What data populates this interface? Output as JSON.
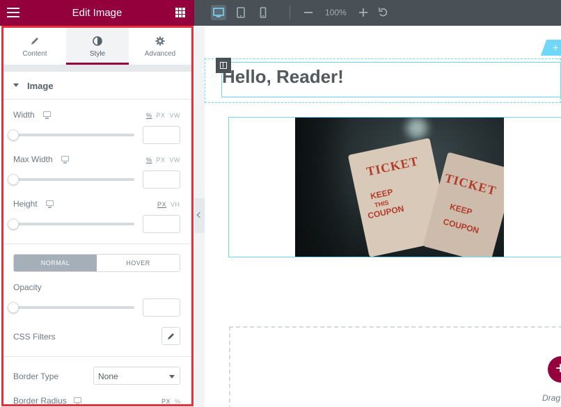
{
  "panel": {
    "title": "Edit Image",
    "tabs": [
      {
        "label": "Content",
        "icon": "pencil-icon"
      },
      {
        "label": "Style",
        "icon": "half-circle-icon"
      },
      {
        "label": "Advanced",
        "icon": "gear-icon"
      }
    ],
    "active_tab": "Style",
    "section_title": "Image",
    "width": {
      "label": "Width",
      "units": [
        "%",
        "PX",
        "VW"
      ],
      "active_unit": "%",
      "value": "",
      "slider_fraction": 0
    },
    "max_width": {
      "label": "Max Width",
      "units": [
        "%",
        "PX",
        "VW"
      ],
      "active_unit": "%",
      "value": "",
      "slider_fraction": 0
    },
    "height": {
      "label": "Height",
      "units": [
        "PX",
        "VH"
      ],
      "active_unit": "PX",
      "value": "",
      "slider_fraction": 0
    },
    "state_tabs": {
      "normal": "NORMAL",
      "hover": "HOVER",
      "active": "NORMAL"
    },
    "opacity": {
      "label": "Opacity",
      "value": "",
      "slider_fraction": 0
    },
    "css_filters": {
      "label": "CSS Filters"
    },
    "border_type": {
      "label": "Border Type",
      "value": "None"
    },
    "border_radius": {
      "label": "Border Radius",
      "units": [
        "PX",
        "%"
      ],
      "active_unit": "PX"
    }
  },
  "toolbar": {
    "zoom": "100%"
  },
  "canvas": {
    "heading": "Hello, Reader!",
    "ticket_words": {
      "ticket": "TICKET",
      "keep": "KEEP",
      "this": "THIS",
      "coupon": "COUPON"
    },
    "drag_text": "Drag w"
  },
  "colors": {
    "brand": "#93003c",
    "toolbar": "#495157",
    "highlight_border": "#e3323e",
    "selection_outline": "#71d7f7"
  }
}
